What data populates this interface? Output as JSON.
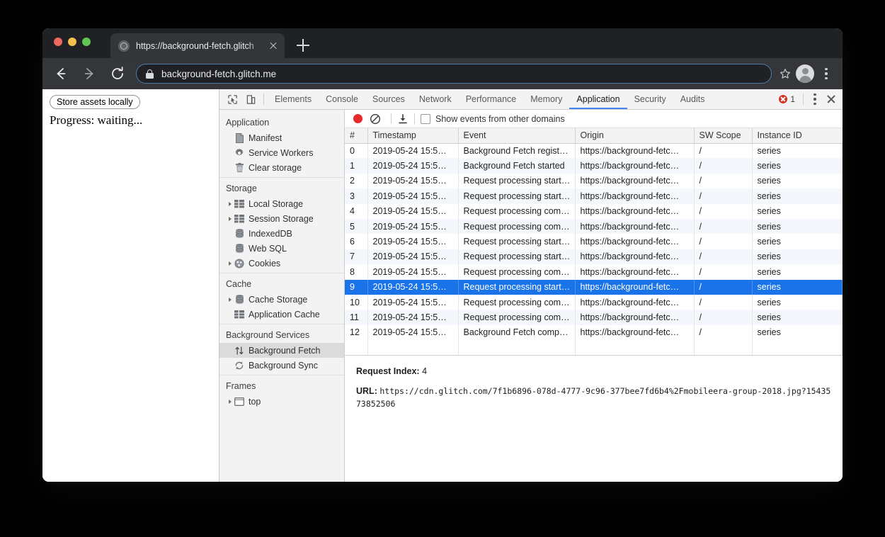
{
  "browser": {
    "tab": {
      "title": "https://background-fetch.glitch",
      "favicon": "globe-icon"
    },
    "omnibox": {
      "url": "background-fetch.glitch.me",
      "lock": "lock-icon"
    },
    "back_label": "Back",
    "forward_label": "Forward",
    "reload_label": "Reload",
    "newtab_label": "New Tab"
  },
  "page": {
    "store_button": "Store assets locally",
    "progress": "Progress: waiting..."
  },
  "devtools": {
    "tabs": [
      {
        "label": "Elements",
        "active": false
      },
      {
        "label": "Console",
        "active": false
      },
      {
        "label": "Sources",
        "active": false
      },
      {
        "label": "Network",
        "active": false
      },
      {
        "label": "Performance",
        "active": false
      },
      {
        "label": "Memory",
        "active": false
      },
      {
        "label": "Application",
        "active": true
      },
      {
        "label": "Security",
        "active": false
      },
      {
        "label": "Audits",
        "active": false
      }
    ],
    "error_count": "1",
    "inspect_icon": "inspect-element-icon",
    "device_icon": "device-toolbar-icon",
    "more_icon": "more-options-icon",
    "close_icon": "close-devtools-icon",
    "accent_color": "#4285f4",
    "error_color": "#d93025"
  },
  "sidebar": {
    "groups": [
      {
        "title": "Application",
        "items": [
          {
            "label": "Manifest",
            "icon": "document-icon",
            "twisty": false,
            "selected": false
          },
          {
            "label": "Service Workers",
            "icon": "gear-icon",
            "twisty": false,
            "selected": false
          },
          {
            "label": "Clear storage",
            "icon": "trash-icon",
            "twisty": false,
            "selected": false
          }
        ]
      },
      {
        "title": "Storage",
        "items": [
          {
            "label": "Local Storage",
            "icon": "table-icon",
            "twisty": true,
            "selected": false
          },
          {
            "label": "Session Storage",
            "icon": "table-icon",
            "twisty": true,
            "selected": false
          },
          {
            "label": "IndexedDB",
            "icon": "database-icon",
            "twisty": false,
            "selected": false
          },
          {
            "label": "Web SQL",
            "icon": "database-icon",
            "twisty": false,
            "selected": false
          },
          {
            "label": "Cookies",
            "icon": "cookie-icon",
            "twisty": true,
            "selected": false
          }
        ]
      },
      {
        "title": "Cache",
        "items": [
          {
            "label": "Cache Storage",
            "icon": "database-icon",
            "twisty": true,
            "selected": false
          },
          {
            "label": "Application Cache",
            "icon": "table-icon",
            "twisty": false,
            "selected": false
          }
        ]
      },
      {
        "title": "Background Services",
        "items": [
          {
            "label": "Background Fetch",
            "icon": "up-down-arrows-icon",
            "twisty": false,
            "selected": true
          },
          {
            "label": "Background Sync",
            "icon": "refresh-icon",
            "twisty": false,
            "selected": false
          }
        ]
      },
      {
        "title": "Frames",
        "items": [
          {
            "label": "top",
            "icon": "frame-icon",
            "twisty": true,
            "selected": false
          }
        ]
      }
    ]
  },
  "events_toolbar": {
    "record_icon": "record-icon",
    "clear_icon": "clear-icon",
    "download_icon": "download-icon",
    "checkbox_label": "Show events from other domains",
    "checkbox_checked": false
  },
  "events_table": {
    "columns": [
      "#",
      "Timestamp",
      "Event",
      "Origin",
      "SW Scope",
      "Instance ID"
    ],
    "rows": [
      {
        "num": "0",
        "timestamp": "2019-05-24 15:5…",
        "event": "Background Fetch regist…",
        "origin": "https://background-fetc…",
        "scope": "/",
        "instance": "series",
        "selected": false
      },
      {
        "num": "1",
        "timestamp": "2019-05-24 15:5…",
        "event": "Background Fetch started",
        "origin": "https://background-fetc…",
        "scope": "/",
        "instance": "series",
        "selected": false
      },
      {
        "num": "2",
        "timestamp": "2019-05-24 15:5…",
        "event": "Request processing start…",
        "origin": "https://background-fetc…",
        "scope": "/",
        "instance": "series",
        "selected": false
      },
      {
        "num": "3",
        "timestamp": "2019-05-24 15:5…",
        "event": "Request processing start…",
        "origin": "https://background-fetc…",
        "scope": "/",
        "instance": "series",
        "selected": false
      },
      {
        "num": "4",
        "timestamp": "2019-05-24 15:5…",
        "event": "Request processing com…",
        "origin": "https://background-fetc…",
        "scope": "/",
        "instance": "series",
        "selected": false
      },
      {
        "num": "5",
        "timestamp": "2019-05-24 15:5…",
        "event": "Request processing com…",
        "origin": "https://background-fetc…",
        "scope": "/",
        "instance": "series",
        "selected": false
      },
      {
        "num": "6",
        "timestamp": "2019-05-24 15:5…",
        "event": "Request processing start…",
        "origin": "https://background-fetc…",
        "scope": "/",
        "instance": "series",
        "selected": false
      },
      {
        "num": "7",
        "timestamp": "2019-05-24 15:5…",
        "event": "Request processing start…",
        "origin": "https://background-fetc…",
        "scope": "/",
        "instance": "series",
        "selected": false
      },
      {
        "num": "8",
        "timestamp": "2019-05-24 15:5…",
        "event": "Request processing com…",
        "origin": "https://background-fetc…",
        "scope": "/",
        "instance": "series",
        "selected": false
      },
      {
        "num": "9",
        "timestamp": "2019-05-24 15:5…",
        "event": "Request processing start…",
        "origin": "https://background-fetc…",
        "scope": "/",
        "instance": "series",
        "selected": true
      },
      {
        "num": "10",
        "timestamp": "2019-05-24 15:5…",
        "event": "Request processing com…",
        "origin": "https://background-fetc…",
        "scope": "/",
        "instance": "series",
        "selected": false
      },
      {
        "num": "11",
        "timestamp": "2019-05-24 15:5…",
        "event": "Request processing com…",
        "origin": "https://background-fetc…",
        "scope": "/",
        "instance": "series",
        "selected": false
      },
      {
        "num": "12",
        "timestamp": "2019-05-24 15:5…",
        "event": "Background Fetch comp…",
        "origin": "https://background-fetc…",
        "scope": "/",
        "instance": "series",
        "selected": false
      }
    ],
    "selection_color": "#1a73e8"
  },
  "detail": {
    "request_index_key": "Request Index:",
    "request_index_value": "4",
    "url_key": "URL:",
    "url_value": "https://cdn.glitch.com/7f1b6896-078d-4777-9c96-377bee7fd6b4%2Fmobileera-group-2018.jpg?1543573852506"
  }
}
